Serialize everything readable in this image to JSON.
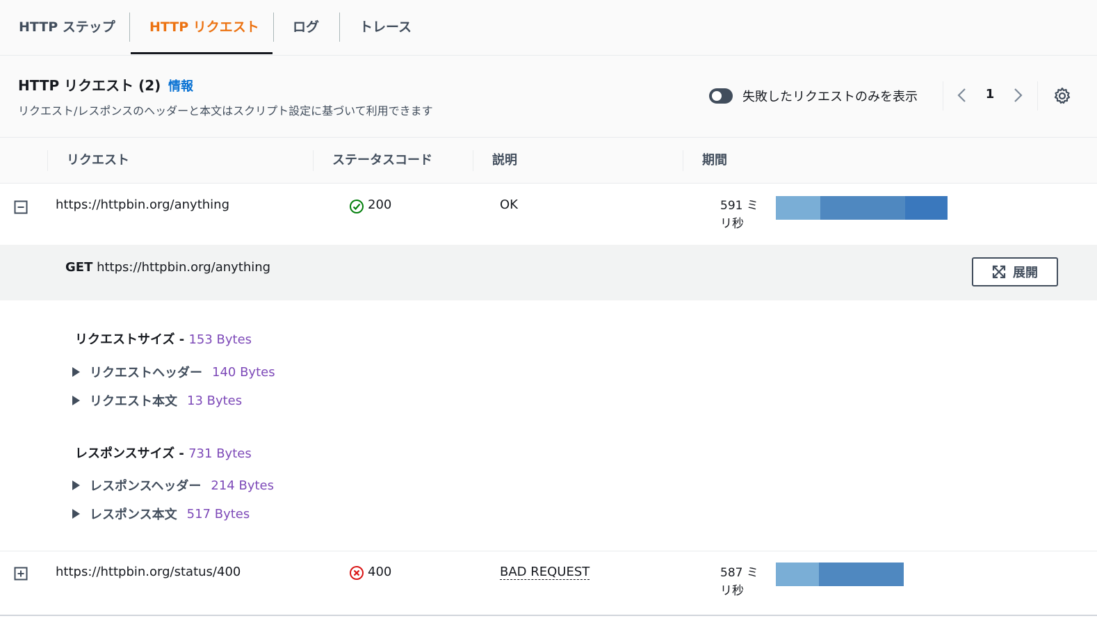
{
  "tabs": [
    {
      "label": "HTTP ステップ",
      "active": false
    },
    {
      "label": "HTTP リクエスト",
      "active": true
    },
    {
      "label": "ログ",
      "active": false
    },
    {
      "label": "トレース",
      "active": false
    }
  ],
  "header": {
    "title": "HTTP リクエスト (2)",
    "info_link": "情報",
    "description": "リクエスト/レスポンスのヘッダーと本文はスクリプト設定に基づいて利用できます",
    "toggle_label": "失敗したリクエストのみを表示",
    "toggle_on": false,
    "page_number": "1"
  },
  "table": {
    "columns": [
      "リクエスト",
      "ステータスコード",
      "説明",
      "期間"
    ],
    "rows": [
      {
        "url": "https://httpbin.org/anything",
        "status": "200",
        "status_kind": "success",
        "description": "OK",
        "duration": "591 ミリ秒",
        "expanded": true
      },
      {
        "url": "https://httpbin.org/status/400",
        "status": "400",
        "status_kind": "error",
        "description": "BAD REQUEST",
        "duration": "587 ミリ秒",
        "expanded": false
      }
    ]
  },
  "detail": {
    "method": "GET",
    "url": "https://httpbin.org/anything",
    "expand_label": "展開",
    "request_size_label": "リクエストサイズ - ",
    "request_size": "153 Bytes",
    "request_headers_label": "リクエストヘッダー",
    "request_headers_size": "140 Bytes",
    "request_body_label": "リクエスト本文",
    "request_body_size": "13 Bytes",
    "response_size_label": "レスポンスサイズ - ",
    "response_size": "731 Bytes",
    "response_headers_label": "レスポンスヘッダー",
    "response_headers_size": "214 Bytes",
    "response_body_label": "レスポンス本文",
    "response_body_size": "517 Bytes"
  },
  "colors": {
    "accent": "#ec7211",
    "link": "#0972d3",
    "bytes": "#7d49b8",
    "success": "#037f0c",
    "error": "#d91515",
    "bar_light": "#7aaed6",
    "bar_mid": "#4f88c0",
    "bar_dark": "#3a78bd"
  }
}
